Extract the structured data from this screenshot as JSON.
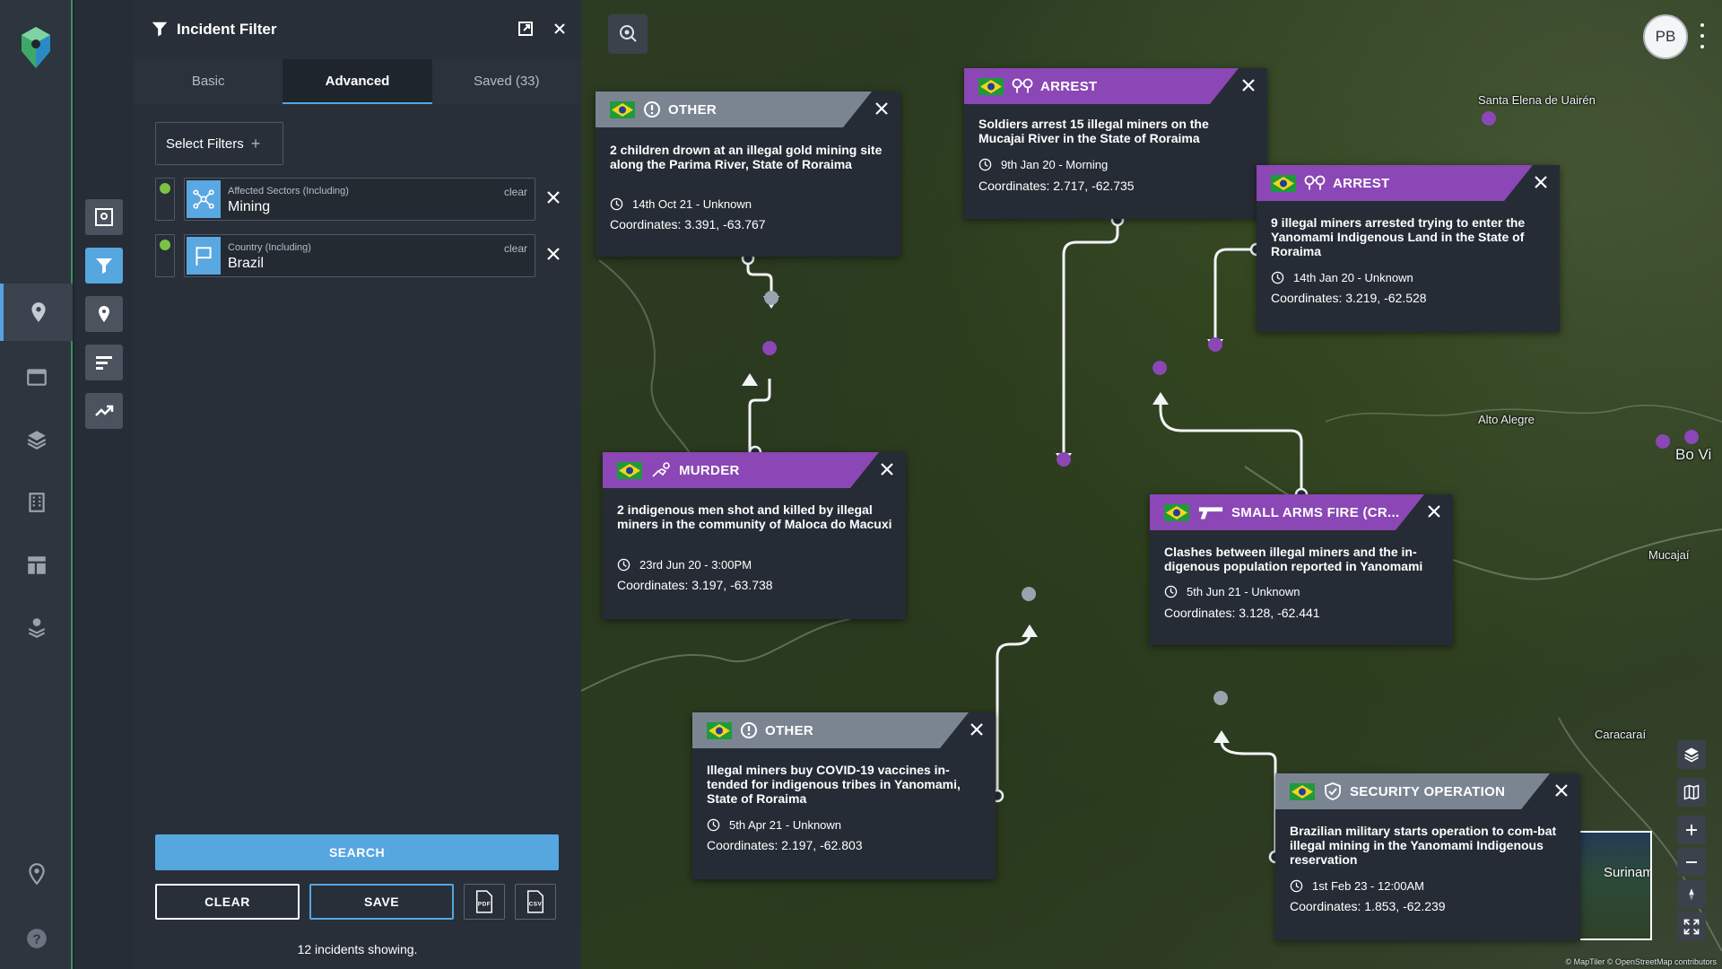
{
  "panel": {
    "title": "Incident Filter",
    "tabs": [
      {
        "label": "Basic"
      },
      {
        "label": "Advanced"
      },
      {
        "label": "Saved (33)"
      }
    ],
    "select_filters_label": "Select Filters",
    "filters": [
      {
        "label": "Affected Sectors (Including)",
        "value": "Mining",
        "clear": "clear",
        "icon": "network-icon"
      },
      {
        "label": "Country (Including)",
        "value": "Brazil",
        "clear": "clear",
        "icon": "flag-icon"
      }
    ],
    "search_label": "SEARCH",
    "clear_label": "CLEAR",
    "save_label": "SAVE",
    "pdf_label": "PDF",
    "csv_label": "CSV",
    "incidents_count": "12 incidents showing."
  },
  "map": {
    "user_initials": "PB",
    "attribution": "© MapTiler © OpenStreetMap contributors",
    "minimap_label": "Surinam",
    "places": [
      {
        "name": "Santa Elena de Uairén"
      },
      {
        "name": "Alto Alegre"
      },
      {
        "name": "Mucajaí"
      },
      {
        "name": "Caracaraí"
      },
      {
        "name": "Bo Vi"
      }
    ],
    "incidents": [
      {
        "category": "OTHER",
        "description": "2 children drown at an illegal gold mining site along the Parima River, State of Roraima",
        "date": "14th Oct 21 - Unknown",
        "coordinates": "Coordinates: 3.391, -63.767"
      },
      {
        "category": "ARREST",
        "description": "Soldiers arrest 15 illegal miners on the Mucajai River in the State of Roraima",
        "date": "9th Jan 20 - Morning",
        "coordinates": "Coordinates: 2.717, -62.735"
      },
      {
        "category": "ARREST",
        "description": "9 illegal miners arrested trying to enter the Yanomami Indigenous Land in the State of Roraima",
        "date": "14th Jan 20 - Unknown",
        "coordinates": "Coordinates: 3.219, -62.528"
      },
      {
        "category": "MURDER",
        "description": "2 indigenous men shot and killed by illegal miners in the community of Maloca do Macuxi",
        "date": "23rd Jun 20 - 3:00PM",
        "coordinates": "Coordinates: 3.197, -63.738"
      },
      {
        "category": "SMALL ARMS FIRE (CR...",
        "description": "Clashes between illegal miners and the in-digenous population reported in Yanomami",
        "date": "5th Jun 21 - Unknown",
        "coordinates": "Coordinates: 3.128, -62.441"
      },
      {
        "category": "OTHER",
        "description": "Illegal miners buy COVID-19 vaccines in-tended for indigenous tribes in Yanomami, State of Roraima",
        "date": "5th Apr 21 - Unknown",
        "coordinates": "Coordinates: 2.197, -62.803"
      },
      {
        "category": "SECURITY OPERATION",
        "description": "Brazilian military starts operation to com-bat illegal mining in the Yanomami Indigenous reservation",
        "date": "1st Feb 23 - 12:00AM",
        "coordinates": "Coordinates: 1.853, -62.239"
      }
    ]
  },
  "colors": {
    "accent": "#56a6e0",
    "category_purple": "#8b47b5",
    "category_grey": "#7b8592",
    "toggle_green": "#7cc243"
  }
}
